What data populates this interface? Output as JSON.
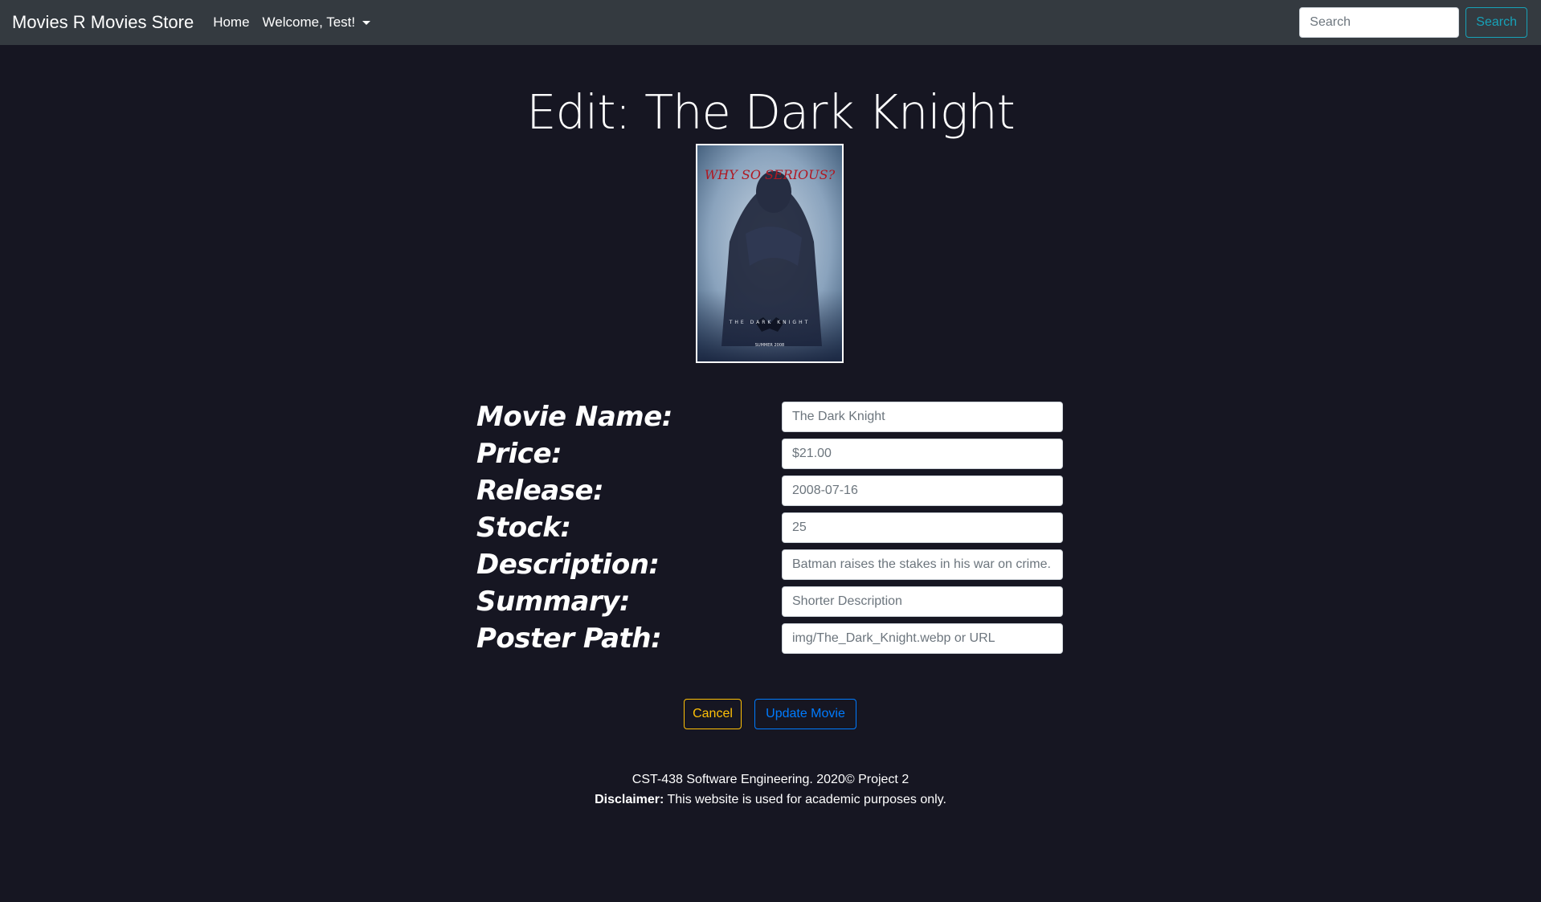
{
  "navbar": {
    "brand": "Movies R Movies Store",
    "home_label": "Home",
    "user_menu_label": "Welcome, Test!",
    "search_placeholder": "Search",
    "search_button_label": "Search"
  },
  "page": {
    "title": "Edit: The Dark Knight",
    "poster": {
      "tagline": "WHY SO SERIOUS?",
      "logo_text": "THE DARK KNIGHT",
      "release_text": "SUMMER 2008"
    }
  },
  "form": {
    "fields": [
      {
        "label": "Movie Name:",
        "placeholder": "The Dark Knight"
      },
      {
        "label": "Price:",
        "placeholder": "$21.00"
      },
      {
        "label": "Release:",
        "placeholder": "2008-07-16"
      },
      {
        "label": "Stock:",
        "placeholder": "25"
      },
      {
        "label": "Description:",
        "placeholder": "Batman raises the stakes in his war on crime. W"
      },
      {
        "label": "Summary:",
        "placeholder": "Shorter Description"
      },
      {
        "label": "Poster Path:",
        "placeholder": "img/The_Dark_Knight.webp or URL"
      }
    ],
    "cancel_label": "Cancel",
    "update_label": "Update Movie"
  },
  "footer": {
    "line1": "CST-438 Software Engineering. 2020© Project 2",
    "disclaimer_label": "Disclaimer:",
    "disclaimer_text": " This website is used for academic purposes only."
  },
  "colors": {
    "background": "#161622",
    "navbar": "#343a40",
    "search_accent": "#17a2b8",
    "cancel_accent": "#ffc107",
    "update_accent": "#007bff"
  }
}
